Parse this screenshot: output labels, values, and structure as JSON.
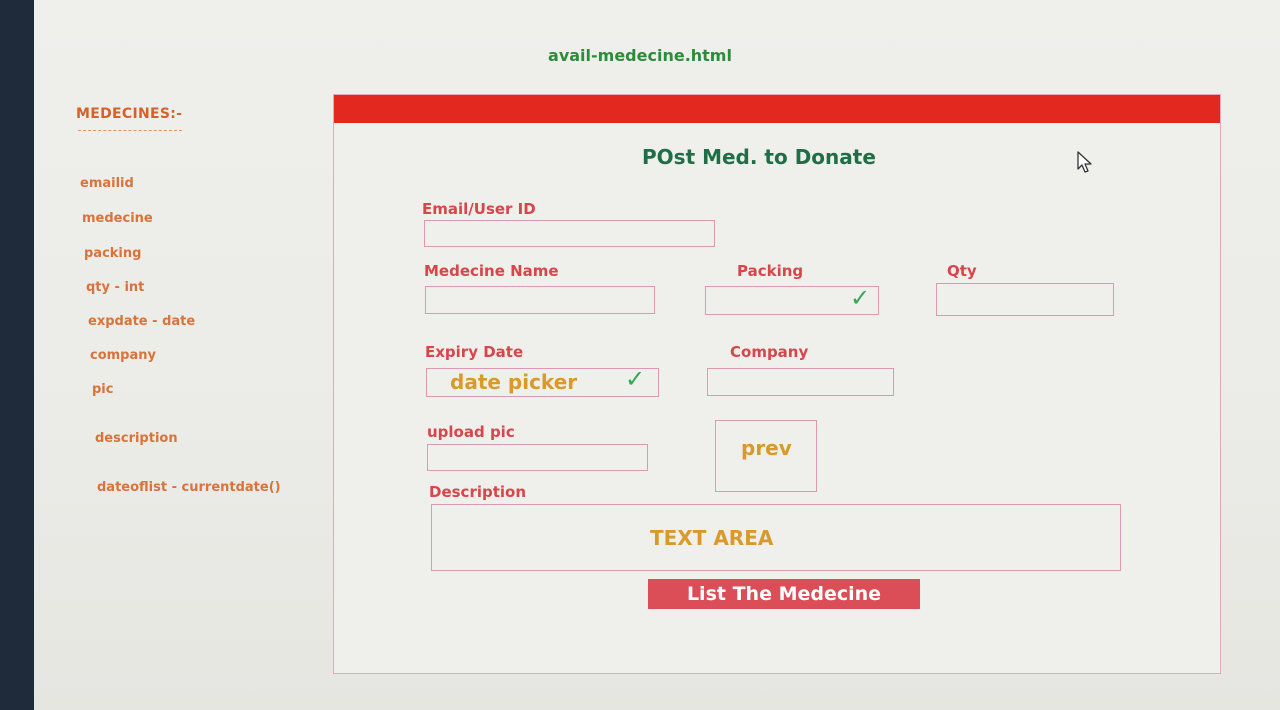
{
  "file_title": "avail-medecine.html",
  "sidebar": {
    "heading": "MEDECINES:-",
    "fields": [
      "emailid",
      "medecine",
      "packing",
      "qty - int",
      "expdate - date",
      "company",
      "pic",
      "description",
      "dateoflist - currentdate()"
    ]
  },
  "form": {
    "title": "POst Med. to Donate",
    "email_label": "Email/User ID",
    "medecine_label": "Medecine Name",
    "packing_label": "Packing",
    "qty_label": "Qty",
    "expiry_label": "Expiry Date",
    "expiry_hint": "date picker",
    "company_label": "Company",
    "upload_label": "upload pic",
    "preview_label": "prev",
    "description_label": "Description",
    "description_hint": "TEXT AREA",
    "submit_label": "List The Medecine"
  },
  "colors": {
    "header_bar": "#e2281f",
    "field_border": "#dd98b6",
    "label": "#d8454a",
    "title": "#1f6e46",
    "hint": "#d99a2b",
    "submit_bg": "#db4d57",
    "check": "#34a853"
  },
  "icons": {
    "packing_check": "checkmark-icon",
    "expiry_check": "checkmark-icon",
    "cursor": "mouse-pointer-icon"
  }
}
